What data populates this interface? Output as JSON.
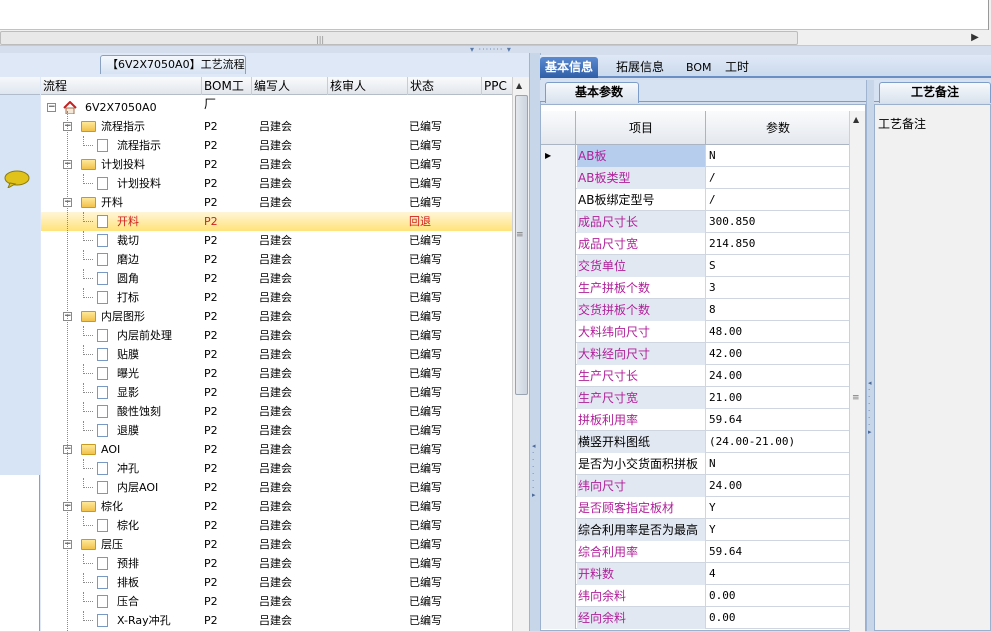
{
  "left_panel": {
    "tab_label": "【6V2X7050A0】工艺流程",
    "columns": [
      "流程",
      "BOM工厂",
      "编写人",
      "核审人",
      "状态",
      "PPC"
    ],
    "root_label": "6V2X7050A0",
    "rows": [
      {
        "label": "流程指示",
        "bom": "P2",
        "writer": "吕建会",
        "reviewer": "",
        "status": "已编写"
      },
      {
        "label": "流程指示",
        "bom": "P2",
        "writer": "吕建会",
        "reviewer": "",
        "status": "已编写"
      },
      {
        "label": "计划投料",
        "bom": "P2",
        "writer": "吕建会",
        "reviewer": "",
        "status": "已编写"
      },
      {
        "label": "计划投料",
        "bom": "P2",
        "writer": "吕建会",
        "reviewer": "",
        "status": "已编写"
      },
      {
        "label": "开料",
        "bom": "P2",
        "writer": "吕建会",
        "reviewer": "",
        "status": "已编写"
      },
      {
        "label": "开料",
        "bom": "P2",
        "writer": "",
        "reviewer": "",
        "status": "回退"
      },
      {
        "label": "裁切",
        "bom": "P2",
        "writer": "吕建会",
        "reviewer": "",
        "status": "已编写"
      },
      {
        "label": "磨边",
        "bom": "P2",
        "writer": "吕建会",
        "reviewer": "",
        "status": "已编写"
      },
      {
        "label": "圆角",
        "bom": "P2",
        "writer": "吕建会",
        "reviewer": "",
        "status": "已编写"
      },
      {
        "label": "打标",
        "bom": "P2",
        "writer": "吕建会",
        "reviewer": "",
        "status": "已编写"
      },
      {
        "label": "内层图形",
        "bom": "P2",
        "writer": "吕建会",
        "reviewer": "",
        "status": "已编写"
      },
      {
        "label": "内层前处理",
        "bom": "P2",
        "writer": "吕建会",
        "reviewer": "",
        "status": "已编写"
      },
      {
        "label": "贴膜",
        "bom": "P2",
        "writer": "吕建会",
        "reviewer": "",
        "status": "已编写"
      },
      {
        "label": "曝光",
        "bom": "P2",
        "writer": "吕建会",
        "reviewer": "",
        "status": "已编写"
      },
      {
        "label": "显影",
        "bom": "P2",
        "writer": "吕建会",
        "reviewer": "",
        "status": "已编写"
      },
      {
        "label": "酸性蚀刻",
        "bom": "P2",
        "writer": "吕建会",
        "reviewer": "",
        "status": "已编写"
      },
      {
        "label": "退膜",
        "bom": "P2",
        "writer": "吕建会",
        "reviewer": "",
        "status": "已编写"
      },
      {
        "label": "AOI",
        "bom": "P2",
        "writer": "吕建会",
        "reviewer": "",
        "status": "已编写"
      },
      {
        "label": "冲孔",
        "bom": "P2",
        "writer": "吕建会",
        "reviewer": "",
        "status": "已编写"
      },
      {
        "label": "内层AOI",
        "bom": "P2",
        "writer": "吕建会",
        "reviewer": "",
        "status": "已编写"
      },
      {
        "label": "棕化",
        "bom": "P2",
        "writer": "吕建会",
        "reviewer": "",
        "status": "已编写"
      },
      {
        "label": "棕化",
        "bom": "P2",
        "writer": "吕建会",
        "reviewer": "",
        "status": "已编写"
      },
      {
        "label": "层压",
        "bom": "P2",
        "writer": "吕建会",
        "reviewer": "",
        "status": "已编写"
      },
      {
        "label": "预排",
        "bom": "P2",
        "writer": "吕建会",
        "reviewer": "",
        "status": "已编写"
      },
      {
        "label": "排板",
        "bom": "P2",
        "writer": "吕建会",
        "reviewer": "",
        "status": "已编写"
      },
      {
        "label": "压合",
        "bom": "P2",
        "writer": "吕建会",
        "reviewer": "",
        "status": "已编写"
      },
      {
        "label": "X-Ray冲孔",
        "bom": "P2",
        "writer": "吕建会",
        "reviewer": "",
        "status": "已编写"
      }
    ]
  },
  "right_panel": {
    "tabs": [
      "基本信息",
      "拓展信息",
      "BOM",
      "工时"
    ],
    "sub_tab": "基本参数",
    "col_item": "项目",
    "col_param": "参数",
    "params": [
      {
        "k": "AB板",
        "v": "N",
        "color": "#b0209a"
      },
      {
        "k": "AB板类型",
        "v": "/",
        "color": "#b0209a"
      },
      {
        "k": "AB板绑定型号",
        "v": "/",
        "color": "#000000"
      },
      {
        "k": "成品尺寸长",
        "v": "300.850",
        "color": "#b0209a"
      },
      {
        "k": "成品尺寸宽",
        "v": "214.850",
        "color": "#b0209a"
      },
      {
        "k": "交货单位",
        "v": "S",
        "color": "#b0209a"
      },
      {
        "k": "生产拼板个数",
        "v": "3",
        "color": "#b0209a"
      },
      {
        "k": "交货拼板个数",
        "v": "8",
        "color": "#b0209a"
      },
      {
        "k": "大料纬向尺寸",
        "v": "48.00",
        "color": "#b0209a"
      },
      {
        "k": "大料经向尺寸",
        "v": "42.00",
        "color": "#b0209a"
      },
      {
        "k": "生产尺寸长",
        "v": "24.00",
        "color": "#b0209a"
      },
      {
        "k": "生产尺寸宽",
        "v": "21.00",
        "color": "#b0209a"
      },
      {
        "k": "拼板利用率",
        "v": "59.64",
        "color": "#b0209a"
      },
      {
        "k": "横竖开料图纸",
        "v": "(24.00-21.00)",
        "color": "#000000"
      },
      {
        "k": "是否为小交货面积拼板",
        "v": "N",
        "color": "#000000"
      },
      {
        "k": "纬向尺寸",
        "v": "24.00",
        "color": "#b0209a"
      },
      {
        "k": "是否顾客指定板材",
        "v": "Y",
        "color": "#b0209a"
      },
      {
        "k": "综合利用率是否为最高",
        "v": "Y",
        "color": "#000000"
      },
      {
        "k": "综合利用率",
        "v": "59.64",
        "color": "#b0209a"
      },
      {
        "k": "开料数",
        "v": "4",
        "color": "#b0209a"
      },
      {
        "k": "纬向余料",
        "v": "0.00",
        "color": "#b0209a"
      },
      {
        "k": "经向余料",
        "v": "0.00",
        "color": "#b0209a"
      }
    ],
    "note_tab": "工艺备注",
    "note_label": "工艺备注"
  }
}
